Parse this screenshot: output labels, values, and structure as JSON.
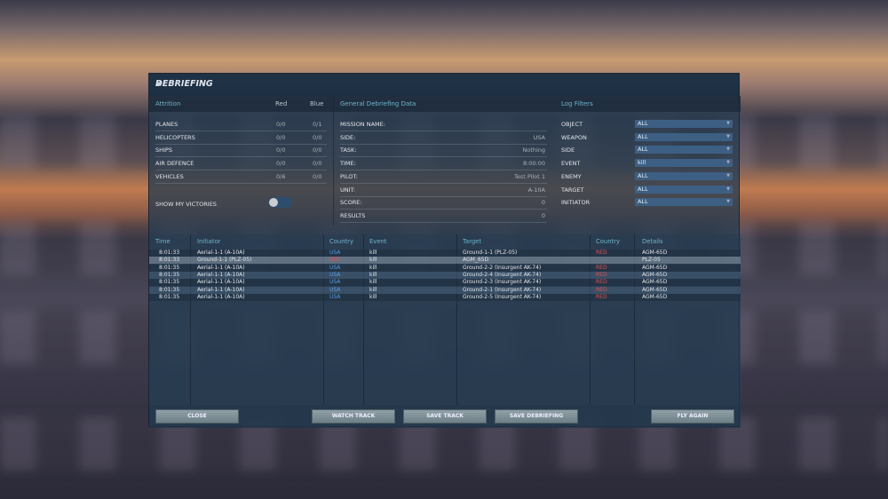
{
  "dialog": {
    "title": "DEBRIEFING",
    "close_icon": "×"
  },
  "attrition": {
    "header": "Attrition",
    "red": "Red",
    "blue": "Blue",
    "rows": [
      {
        "label": "PLANES",
        "red": "0/0",
        "blue": "0/1"
      },
      {
        "label": "HELICOPTERS",
        "red": "0/0",
        "blue": "0/0"
      },
      {
        "label": "SHIPS",
        "red": "0/0",
        "blue": "0/0"
      },
      {
        "label": "AIR DEFENCE",
        "red": "0/0",
        "blue": "0/0"
      },
      {
        "label": "VEHICLES",
        "red": "0/6",
        "blue": "0/0"
      }
    ],
    "show_victories": "SHOW MY VICTORIES",
    "show_victories_on": false
  },
  "general": {
    "header": "General Debriefing Data",
    "rows": [
      {
        "label": "MISSION NAME:",
        "value": ""
      },
      {
        "label": "SIDE:",
        "value": "USA"
      },
      {
        "label": "TASK:",
        "value": "Nothing"
      },
      {
        "label": "TIME:",
        "value": "8:00:00"
      },
      {
        "label": "PILOT:",
        "value": "Test Pilot 1"
      },
      {
        "label": "UNIT:",
        "value": "A-10A"
      },
      {
        "label": "SCORE:",
        "value": "0"
      },
      {
        "label": "RESULTS",
        "value": "0"
      }
    ]
  },
  "filters": {
    "header": "Log Filters",
    "rows": [
      {
        "label": "OBJECT",
        "value": "ALL"
      },
      {
        "label": "WEAPON",
        "value": "ALL"
      },
      {
        "label": "SIDE",
        "value": "ALL"
      },
      {
        "label": "EVENT",
        "value": "kill"
      },
      {
        "label": "ENEMY",
        "value": "ALL"
      },
      {
        "label": "TARGET",
        "value": "ALL"
      },
      {
        "label": "INITIATOR",
        "value": "ALL"
      }
    ]
  },
  "log": {
    "columns": [
      "Time",
      "Initiator",
      "Country",
      "Event",
      "Target",
      "Country",
      "Details"
    ],
    "rows": [
      [
        "8:01:33",
        "Aerial-1-1 (A-10A)",
        "USA",
        "kill",
        "Ground-1-1 (PLZ-05)",
        "RED",
        "AGM-65D"
      ],
      [
        "8:01:33",
        "Ground-1-1 (PLZ-05)",
        "RED",
        "kill",
        "AGM_65D",
        "",
        "PLZ-05"
      ],
      [
        "8:01:35",
        "Aerial-1-1 (A-10A)",
        "USA",
        "kill",
        "Ground-2-2 (Insurgent AK-74)",
        "RED",
        "AGM-65D"
      ],
      [
        "8:01:35",
        "Aerial-1-1 (A-10A)",
        "USA",
        "kill",
        "Ground-2-4 (Insurgent AK-74)",
        "RED",
        "AGM-65D"
      ],
      [
        "8:01:35",
        "Aerial-1-1 (A-10A)",
        "USA",
        "kill",
        "Ground-2-3 (Insurgent AK-74)",
        "RED",
        "AGM-65D"
      ],
      [
        "8:01:35",
        "Aerial-1-1 (A-10A)",
        "USA",
        "kill",
        "Ground-2-1 (Insurgent AK-74)",
        "RED",
        "AGM-65D"
      ],
      [
        "8:01:35",
        "Aerial-1-1 (A-10A)",
        "USA",
        "kill",
        "Ground-2-5 (Insurgent AK-74)",
        "RED",
        "AGM-65D"
      ]
    ]
  },
  "buttons": {
    "close": "CLOSE",
    "watch": "WATCH TRACK",
    "save_track": "SAVE TRACK",
    "save_debriefing": "SAVE DEBRIEFING",
    "fly_again": "FLY AGAIN"
  },
  "colors": {
    "usa": "#5a9fe0",
    "red": "#e05050",
    "accent": "#6fb4cc"
  }
}
